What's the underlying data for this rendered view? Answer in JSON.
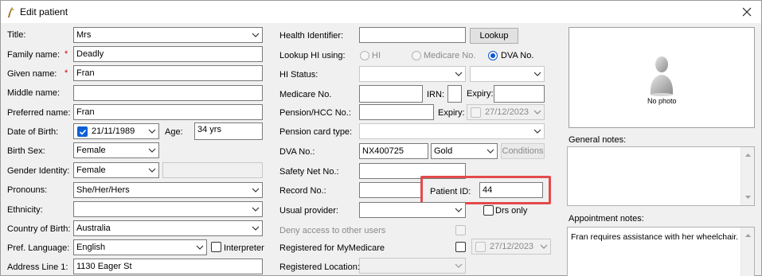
{
  "window": {
    "title": "Edit patient"
  },
  "left": {
    "title": {
      "label": "Title:",
      "value": "Mrs"
    },
    "family_name": {
      "label": "Family name:",
      "value": "Deadly"
    },
    "given_name": {
      "label": "Given name:",
      "value": "Fran"
    },
    "middle_name": {
      "label": "Middle name:",
      "value": ""
    },
    "preferred_name": {
      "label": "Preferred name:",
      "value": "Fran"
    },
    "dob": {
      "label": "Date of Birth:",
      "value": "21/11/1989",
      "age_label": "Age:",
      "age_value": "34 yrs"
    },
    "birth_sex": {
      "label": "Birth Sex:",
      "value": "Female"
    },
    "gender_identity": {
      "label": "Gender Identity:",
      "value": "Female",
      "other": ""
    },
    "pronouns": {
      "label": "Pronouns:",
      "value": "She/Her/Hers"
    },
    "ethnicity": {
      "label": "Ethnicity:",
      "value": ""
    },
    "country_of_birth": {
      "label": "Country of Birth:",
      "value": "Australia"
    },
    "pref_language": {
      "label": "Pref. Language:",
      "value": "English",
      "interpreter_label": "Interpreter"
    },
    "address_line1": {
      "label": "Address Line 1:",
      "value": "1130 Eager St"
    },
    "required_mark": "*"
  },
  "middle": {
    "health_identifier": {
      "label": "Health Identifier:",
      "value": "",
      "lookup_label": "Lookup"
    },
    "lookup_hi_using": {
      "label": "Lookup HI using:",
      "options": [
        "HI",
        "Medicare No.",
        "DVA No."
      ],
      "selected": "DVA No."
    },
    "hi_status": {
      "label": "HI Status:",
      "value": "",
      "value2": ""
    },
    "medicare_no": {
      "label": "Medicare No.",
      "value": "",
      "irn_label": "IRN:",
      "irn_value": "",
      "expiry_label": "Expiry:",
      "expiry_value": ""
    },
    "pension": {
      "label": "Pension/HCC No.:",
      "value": "",
      "expiry_label": "Expiry:",
      "expiry_value": "27/12/2023"
    },
    "pension_card_type": {
      "label": "Pension card type:",
      "value": ""
    },
    "dva_no": {
      "label": "DVA No.:",
      "value": "NX400725",
      "card": "Gold",
      "conditions_label": "Conditions"
    },
    "safety_net_no": {
      "label": "Safety Net No.:",
      "value": ""
    },
    "record_no": {
      "label": "Record No.:",
      "value": "",
      "patient_id_label": "Patient ID:",
      "patient_id_value": "44"
    },
    "usual_provider": {
      "label": "Usual provider:",
      "value": "",
      "drs_only_label": "Drs only"
    },
    "deny_access": {
      "label": "Deny access to other users"
    },
    "registered_mymedicare": {
      "label": "Registered for MyMedicare",
      "date": "27/12/2023"
    },
    "registered_location": {
      "label": "Registered Location:",
      "value": ""
    }
  },
  "right": {
    "photo_text": "No photo",
    "general_notes_label": "General notes:",
    "general_notes": "",
    "appointment_notes_label": "Appointment notes:",
    "appointment_notes": "Fran requires assistance with her wheelchair."
  },
  "colors": {
    "accent": "#0b57d0",
    "highlight": "#e34b4b"
  }
}
